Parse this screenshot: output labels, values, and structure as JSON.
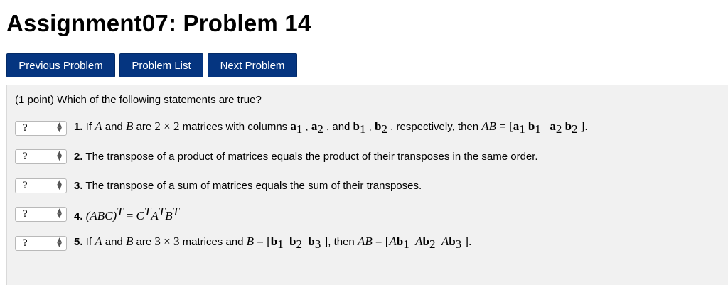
{
  "page": {
    "title": "Assignment07: Problem 14"
  },
  "nav": {
    "previous": "Previous Problem",
    "list": "Problem List",
    "next": "Next Problem"
  },
  "problem": {
    "intro": "(1 point) Which of the following statements are true?",
    "select_value": "?",
    "statements": [
      {
        "number": "1.",
        "text": "If A and B are 2 × 2 matrices with columns a₁, a₂, and b₁, b₂, respectively, then AB = [a₁b₁ a₂b₂]."
      },
      {
        "number": "2.",
        "text": "The transpose of a product of matrices equals the product of their transposes in the same order."
      },
      {
        "number": "3.",
        "text": "The transpose of a sum of matrices equals the sum of their transposes."
      },
      {
        "number": "4.",
        "text": "(ABC)ᵀ = CᵀAᵀBᵀ"
      },
      {
        "number": "5.",
        "text": "If A and B are 3 × 3 matrices and B = [b₁ b₂ b₃], then AB = [Ab₁ Ab₂ Ab₃]."
      }
    ]
  }
}
